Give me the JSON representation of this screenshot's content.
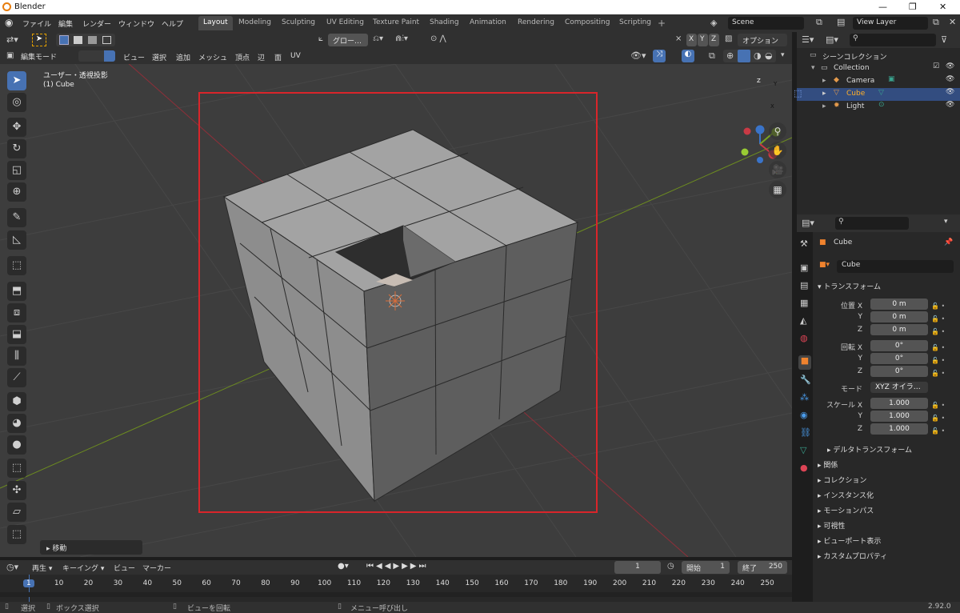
{
  "app": {
    "title": "Blender",
    "version": "2.92.0"
  },
  "menus": [
    "ファイル",
    "編集",
    "レンダー",
    "ウィンドウ",
    "ヘルプ"
  ],
  "workspaces": [
    {
      "label": "Layout",
      "active": true
    },
    {
      "label": "Modeling"
    },
    {
      "label": "Sculpting"
    },
    {
      "label": "UV Editing"
    },
    {
      "label": "Texture Paint"
    },
    {
      "label": "Shading"
    },
    {
      "label": "Animation"
    },
    {
      "label": "Rendering"
    },
    {
      "label": "Compositing"
    },
    {
      "label": "Scripting"
    }
  ],
  "scene": "Scene",
  "view_layer": "View Layer",
  "viewport": {
    "mode": "編集モード",
    "menus": [
      "ビュー",
      "選択",
      "追加",
      "メッシュ",
      "頂点",
      "辺",
      "面",
      "UV"
    ],
    "transform_orientation": "グロー…",
    "options": "オプション",
    "xyz": [
      "X",
      "Y",
      "Z"
    ],
    "view_name": "ユーザー・透視投影",
    "object_name": "(1) Cube",
    "last_op": "移動",
    "highlight_color": "#d9252a"
  },
  "outliner": {
    "scene_collection": "シーンコレクション",
    "collection": "Collection",
    "items": [
      {
        "label": "Camera",
        "selected": false
      },
      {
        "label": "Cube",
        "selected": true
      },
      {
        "label": "Light",
        "selected": false
      }
    ]
  },
  "properties": {
    "object": "Cube",
    "name_field": "Cube",
    "transform_header": "トランスフォーム",
    "location": {
      "label": "位置 X",
      "x": "0 m",
      "y": "0 m",
      "z": "0 m"
    },
    "rotation": {
      "label": "回転 X",
      "x": "0°",
      "y": "0°",
      "z": "0°"
    },
    "mode_label": "モード",
    "mode_value": "XYZ オイラ…",
    "scale": {
      "label": "スケール X",
      "x": "1.000",
      "y": "1.000",
      "z": "1.000"
    },
    "axis_y": "Y",
    "axis_z": "Z",
    "delta": "デルタトランスフォーム",
    "panels": [
      "関係",
      "コレクション",
      "インスタンス化",
      "モーションパス",
      "可視性",
      "ビューポート表示",
      "カスタムプロパティ"
    ]
  },
  "timeline": {
    "menus": [
      "再生",
      "キーイング",
      "ビュー",
      "マーカー"
    ],
    "current_frame": "1",
    "start_label": "開始",
    "start": "1",
    "end_label": "終了",
    "end": "250",
    "ticks": [
      "1",
      "10",
      "20",
      "30",
      "40",
      "50",
      "60",
      "70",
      "80",
      "90",
      "100",
      "110",
      "120",
      "130",
      "140",
      "150",
      "160",
      "170",
      "180",
      "190",
      "200",
      "210",
      "220",
      "230",
      "240",
      "250"
    ]
  },
  "status": {
    "select": "選択",
    "box_select": "ボックス選択",
    "rotate_view": "ビューを回転",
    "call_menu": "メニュー呼び出し"
  }
}
